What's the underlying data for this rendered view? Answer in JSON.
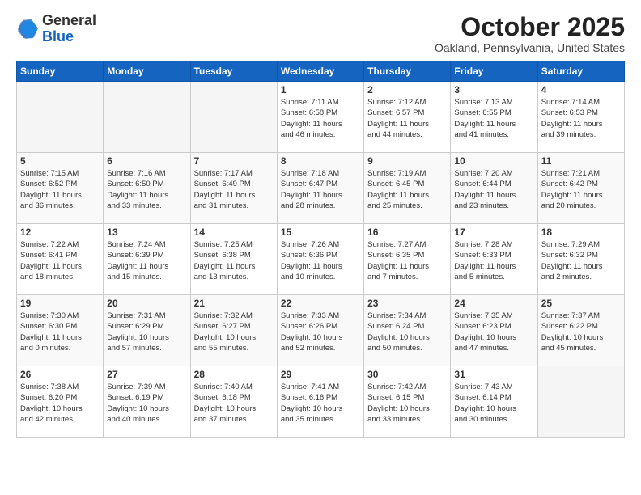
{
  "header": {
    "logo_general": "General",
    "logo_blue": "Blue",
    "month_title": "October 2025",
    "location": "Oakland, Pennsylvania, United States"
  },
  "weekdays": [
    "Sunday",
    "Monday",
    "Tuesday",
    "Wednesday",
    "Thursday",
    "Friday",
    "Saturday"
  ],
  "weeks": [
    [
      {
        "day": "",
        "info": ""
      },
      {
        "day": "",
        "info": ""
      },
      {
        "day": "",
        "info": ""
      },
      {
        "day": "1",
        "info": "Sunrise: 7:11 AM\nSunset: 6:58 PM\nDaylight: 11 hours\nand 46 minutes."
      },
      {
        "day": "2",
        "info": "Sunrise: 7:12 AM\nSunset: 6:57 PM\nDaylight: 11 hours\nand 44 minutes."
      },
      {
        "day": "3",
        "info": "Sunrise: 7:13 AM\nSunset: 6:55 PM\nDaylight: 11 hours\nand 41 minutes."
      },
      {
        "day": "4",
        "info": "Sunrise: 7:14 AM\nSunset: 6:53 PM\nDaylight: 11 hours\nand 39 minutes."
      }
    ],
    [
      {
        "day": "5",
        "info": "Sunrise: 7:15 AM\nSunset: 6:52 PM\nDaylight: 11 hours\nand 36 minutes."
      },
      {
        "day": "6",
        "info": "Sunrise: 7:16 AM\nSunset: 6:50 PM\nDaylight: 11 hours\nand 33 minutes."
      },
      {
        "day": "7",
        "info": "Sunrise: 7:17 AM\nSunset: 6:49 PM\nDaylight: 11 hours\nand 31 minutes."
      },
      {
        "day": "8",
        "info": "Sunrise: 7:18 AM\nSunset: 6:47 PM\nDaylight: 11 hours\nand 28 minutes."
      },
      {
        "day": "9",
        "info": "Sunrise: 7:19 AM\nSunset: 6:45 PM\nDaylight: 11 hours\nand 25 minutes."
      },
      {
        "day": "10",
        "info": "Sunrise: 7:20 AM\nSunset: 6:44 PM\nDaylight: 11 hours\nand 23 minutes."
      },
      {
        "day": "11",
        "info": "Sunrise: 7:21 AM\nSunset: 6:42 PM\nDaylight: 11 hours\nand 20 minutes."
      }
    ],
    [
      {
        "day": "12",
        "info": "Sunrise: 7:22 AM\nSunset: 6:41 PM\nDaylight: 11 hours\nand 18 minutes."
      },
      {
        "day": "13",
        "info": "Sunrise: 7:24 AM\nSunset: 6:39 PM\nDaylight: 11 hours\nand 15 minutes."
      },
      {
        "day": "14",
        "info": "Sunrise: 7:25 AM\nSunset: 6:38 PM\nDaylight: 11 hours\nand 13 minutes."
      },
      {
        "day": "15",
        "info": "Sunrise: 7:26 AM\nSunset: 6:36 PM\nDaylight: 11 hours\nand 10 minutes."
      },
      {
        "day": "16",
        "info": "Sunrise: 7:27 AM\nSunset: 6:35 PM\nDaylight: 11 hours\nand 7 minutes."
      },
      {
        "day": "17",
        "info": "Sunrise: 7:28 AM\nSunset: 6:33 PM\nDaylight: 11 hours\nand 5 minutes."
      },
      {
        "day": "18",
        "info": "Sunrise: 7:29 AM\nSunset: 6:32 PM\nDaylight: 11 hours\nand 2 minutes."
      }
    ],
    [
      {
        "day": "19",
        "info": "Sunrise: 7:30 AM\nSunset: 6:30 PM\nDaylight: 11 hours\nand 0 minutes."
      },
      {
        "day": "20",
        "info": "Sunrise: 7:31 AM\nSunset: 6:29 PM\nDaylight: 10 hours\nand 57 minutes."
      },
      {
        "day": "21",
        "info": "Sunrise: 7:32 AM\nSunset: 6:27 PM\nDaylight: 10 hours\nand 55 minutes."
      },
      {
        "day": "22",
        "info": "Sunrise: 7:33 AM\nSunset: 6:26 PM\nDaylight: 10 hours\nand 52 minutes."
      },
      {
        "day": "23",
        "info": "Sunrise: 7:34 AM\nSunset: 6:24 PM\nDaylight: 10 hours\nand 50 minutes."
      },
      {
        "day": "24",
        "info": "Sunrise: 7:35 AM\nSunset: 6:23 PM\nDaylight: 10 hours\nand 47 minutes."
      },
      {
        "day": "25",
        "info": "Sunrise: 7:37 AM\nSunset: 6:22 PM\nDaylight: 10 hours\nand 45 minutes."
      }
    ],
    [
      {
        "day": "26",
        "info": "Sunrise: 7:38 AM\nSunset: 6:20 PM\nDaylight: 10 hours\nand 42 minutes."
      },
      {
        "day": "27",
        "info": "Sunrise: 7:39 AM\nSunset: 6:19 PM\nDaylight: 10 hours\nand 40 minutes."
      },
      {
        "day": "28",
        "info": "Sunrise: 7:40 AM\nSunset: 6:18 PM\nDaylight: 10 hours\nand 37 minutes."
      },
      {
        "day": "29",
        "info": "Sunrise: 7:41 AM\nSunset: 6:16 PM\nDaylight: 10 hours\nand 35 minutes."
      },
      {
        "day": "30",
        "info": "Sunrise: 7:42 AM\nSunset: 6:15 PM\nDaylight: 10 hours\nand 33 minutes."
      },
      {
        "day": "31",
        "info": "Sunrise: 7:43 AM\nSunset: 6:14 PM\nDaylight: 10 hours\nand 30 minutes."
      },
      {
        "day": "",
        "info": ""
      }
    ]
  ]
}
